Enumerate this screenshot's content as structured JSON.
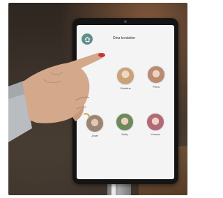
{
  "screen": {
    "title": "Dina kontakter",
    "home_icon": "home-icon",
    "contacts": [
      {
        "name": "Christine",
        "avatar_color": "#c9a27a"
      },
      {
        "name": "Piera",
        "avatar_color": "#b98b73"
      },
      {
        "name": "Josef",
        "avatar_color": "#9a8575"
      },
      {
        "name": "Nelly",
        "avatar_color": "#6f8a5a"
      },
      {
        "name": "Yvonne",
        "avatar_color": "#b36a78"
      }
    ]
  },
  "colors": {
    "home_button": "#5f8e8a",
    "nail_polish": "#c8323a",
    "skin": "#d4a88a"
  }
}
